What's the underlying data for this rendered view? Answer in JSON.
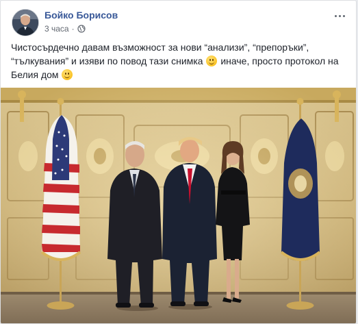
{
  "post": {
    "author": "Бойко Борисов",
    "time": "3 часа",
    "separator": "·",
    "privacy_icon": "globe-icon",
    "menu_icon": "more-dots-icon",
    "text_line1": "Чистосърдечно давам възможност за нови “анализи”, “препоръки”,",
    "text_line2a": "“тълкувания” и изяви по повод тази снимка",
    "text_line2b": "иначе, просто протокол на",
    "text_line3": "Белия дом",
    "emoji_icon": "smiley-emoji-icon"
  },
  "colors": {
    "author_link": "#385898",
    "body_text": "#1d2129",
    "meta_text": "#616770"
  }
}
